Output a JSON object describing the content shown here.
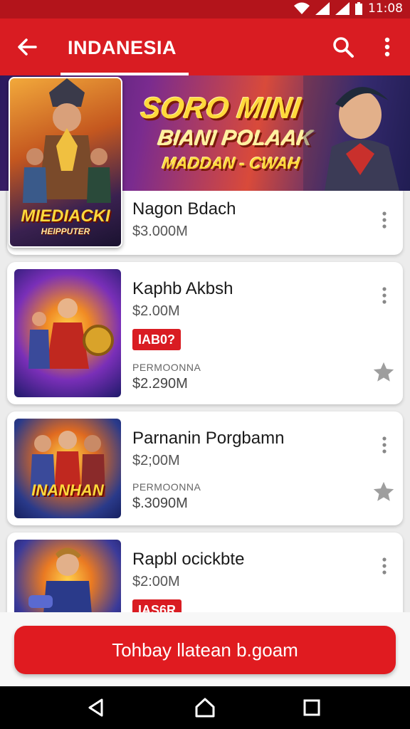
{
  "status_bar": {
    "time": "11:08"
  },
  "app_bar": {
    "title": "INDANESIA"
  },
  "banner": {
    "line1": "SORO MINI",
    "line2": "BIANI POLAAK",
    "line3": "MADDAN - CWAH"
  },
  "featured_thumb": {
    "label1": "MIEDIACKI",
    "label2": "HEIPPUTER"
  },
  "items": [
    {
      "title": "Nagon Bdach",
      "price": "$3.000M"
    },
    {
      "title": "Kaphb Akbsh",
      "price": "$2.00M",
      "tag": "IAB0?",
      "subtitle": "PERMOONNA",
      "price2": "$2.290M"
    },
    {
      "title": "Parnanin Porgbamn",
      "price": "$2;00M",
      "subtitle": "PERMOONNA",
      "price2": "$.3090M",
      "thumb_label": "INANHAN"
    },
    {
      "title": "Rapbl ocickbte",
      "price": "$2:00M",
      "tag": "IAS6R"
    }
  ],
  "cta": {
    "label": "Tohbay llatean b.goam"
  },
  "colors": {
    "primary": "#d91c22",
    "status": "#b3141b",
    "star": "#9e9e9e"
  },
  "icons": [
    "back-arrow-icon",
    "search-icon",
    "more-vert-icon",
    "star-icon",
    "nav-back-icon",
    "nav-home-icon",
    "nav-recents-icon"
  ]
}
